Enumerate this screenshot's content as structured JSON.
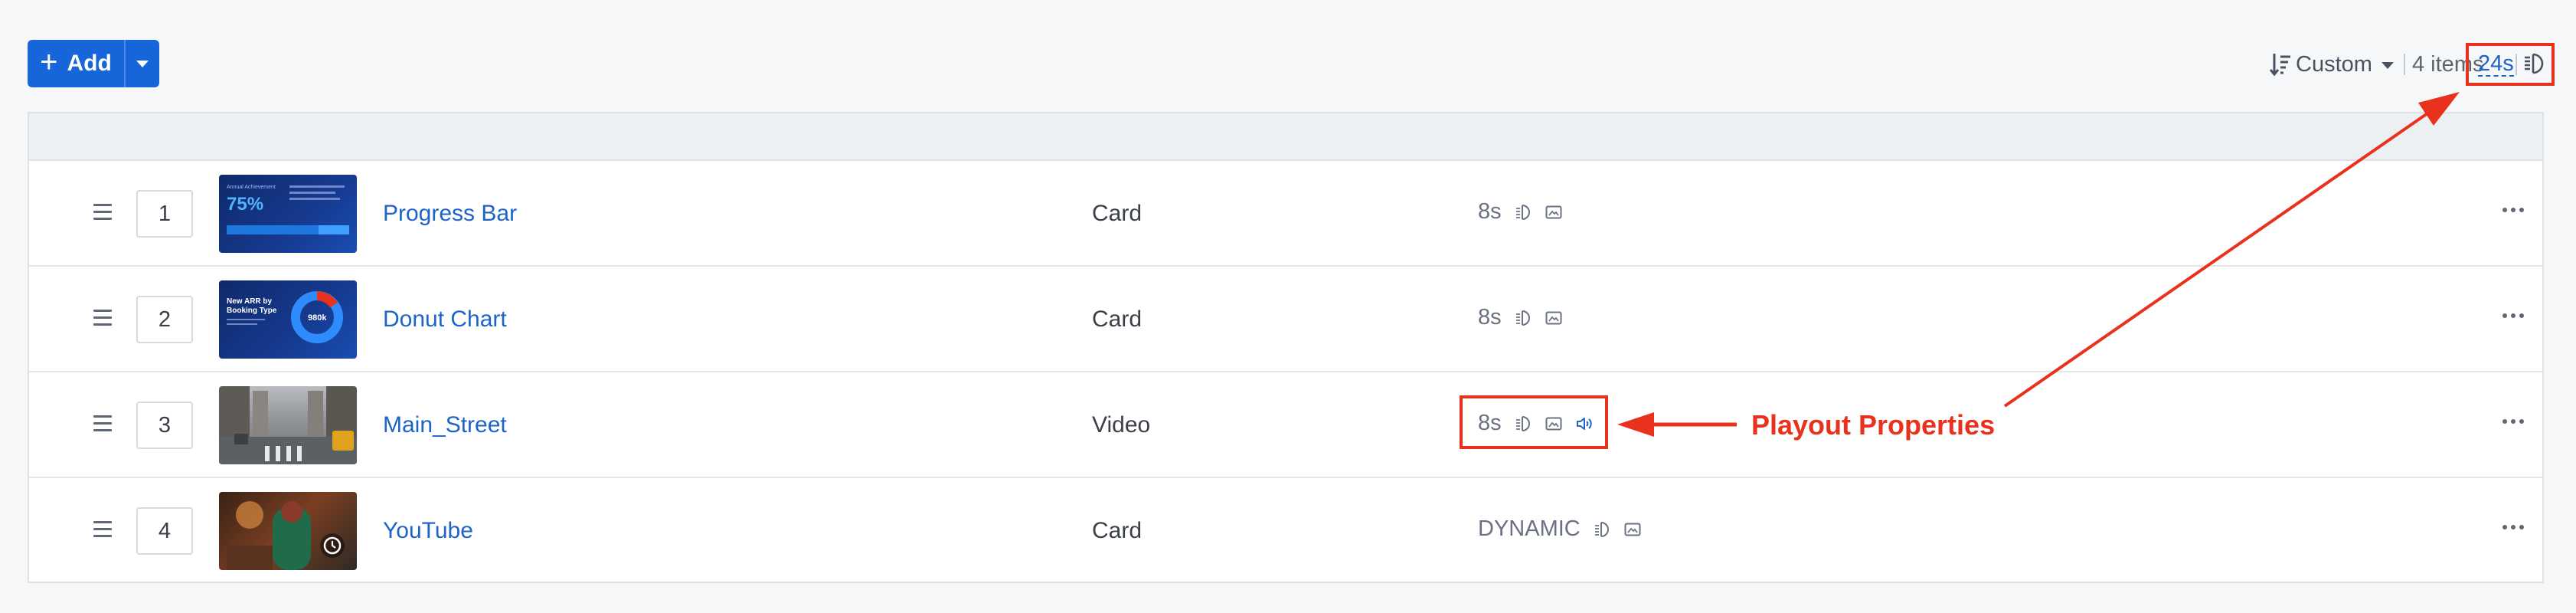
{
  "toolbar": {
    "add_label": "Add",
    "sort_label": "Custom",
    "items_count": "4 items",
    "total_duration": "24s"
  },
  "rows": [
    {
      "order": "1",
      "name": "Progress Bar",
      "type": "Card",
      "duration": "8s",
      "icons": [
        "duration-mode-icon",
        "image-icon"
      ],
      "thumb_text": [
        "Annual Achievement",
        "75%"
      ]
    },
    {
      "order": "2",
      "name": "Donut Chart",
      "type": "Card",
      "duration": "8s",
      "icons": [
        "duration-mode-icon",
        "image-icon"
      ],
      "thumb_text": [
        "New ARR by",
        "Booking Type",
        "980k"
      ]
    },
    {
      "order": "3",
      "name": "Main_Street",
      "type": "Video",
      "duration": "8s",
      "icons": [
        "duration-mode-icon",
        "image-icon",
        "volume-icon"
      ]
    },
    {
      "order": "4",
      "name": "YouTube",
      "type": "Card",
      "duration": "DYNAMIC",
      "icons": [
        "duration-mode-icon",
        "image-icon"
      ]
    }
  ],
  "annotation": {
    "label": "Playout Properties"
  },
  "colors": {
    "accent": "#1666d9",
    "link": "#1d63c8",
    "annotation": "#e8321e"
  }
}
